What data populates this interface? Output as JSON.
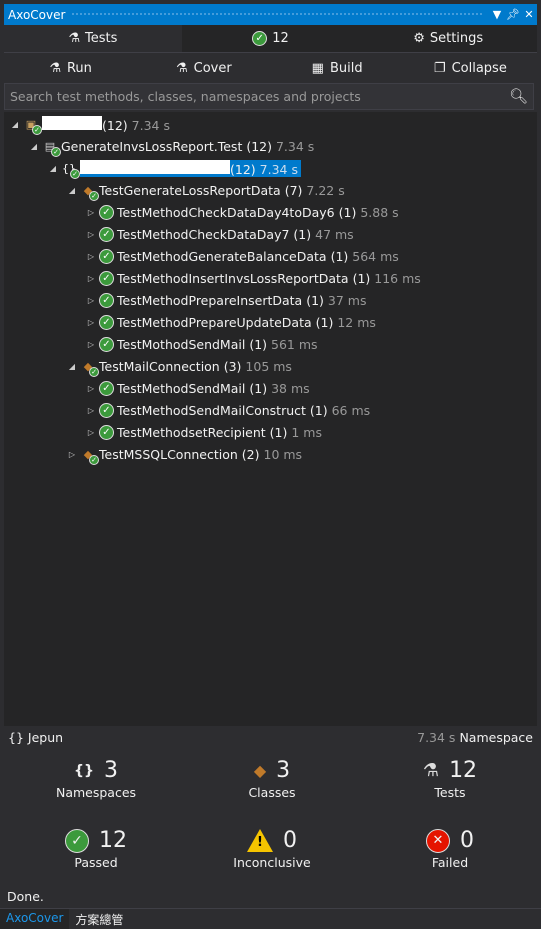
{
  "window": {
    "title": "AxoCover"
  },
  "tabs": [
    {
      "label": "Tests",
      "icon": "flask-tests-icon"
    },
    {
      "label": "12",
      "icon": "check-circle-icon"
    },
    {
      "label": "Settings",
      "icon": "gear-icon"
    }
  ],
  "toolbar": {
    "run": "Run",
    "cover": "Cover",
    "build": "Build",
    "collapse": "Collapse"
  },
  "search": {
    "placeholder": "Search test methods, classes, namespaces and projects"
  },
  "tree": [
    {
      "level": 0,
      "kind": "solution",
      "name": "",
      "redacted": true,
      "count": "(12)",
      "time": "7.34 s",
      "expanded": true
    },
    {
      "level": 1,
      "kind": "project",
      "name": "GenerateInvsLossReport.Test",
      "count": "(12)",
      "time": "7.34 s",
      "expanded": true
    },
    {
      "level": 2,
      "kind": "namespace",
      "name": "",
      "redacted": true,
      "count": "(12)",
      "time": "7.34 s",
      "expanded": true,
      "selected": true
    },
    {
      "level": 3,
      "kind": "class",
      "name": "TestGenerateLossReportData",
      "count": "(7)",
      "time": "7.22 s",
      "expanded": true
    },
    {
      "level": 4,
      "kind": "test",
      "name": "TestMethodCheckDataDay4toDay6",
      "count": "(1)",
      "time": "5.88 s"
    },
    {
      "level": 4,
      "kind": "test",
      "name": "TestMethodCheckDataDay7",
      "count": "(1)",
      "time": "47 ms"
    },
    {
      "level": 4,
      "kind": "test",
      "name": "TestMethodGenerateBalanceData",
      "count": "(1)",
      "time": "564 ms"
    },
    {
      "level": 4,
      "kind": "test",
      "name": "TestMethodInsertInvsLossReportData",
      "count": "(1)",
      "time": "116 ms"
    },
    {
      "level": 4,
      "kind": "test",
      "name": "TestMethodPrepareInsertData",
      "count": "(1)",
      "time": "37 ms"
    },
    {
      "level": 4,
      "kind": "test",
      "name": "TestMethodPrepareUpdateData",
      "count": "(1)",
      "time": "12 ms"
    },
    {
      "level": 4,
      "kind": "test",
      "name": "TestMothodSendMail",
      "count": "(1)",
      "time": "561 ms"
    },
    {
      "level": 3,
      "kind": "class",
      "name": "TestMailConnection",
      "count": "(3)",
      "time": "105 ms",
      "expanded": true
    },
    {
      "level": 4,
      "kind": "test",
      "name": "TestMethodSendMail",
      "count": "(1)",
      "time": "38 ms"
    },
    {
      "level": 4,
      "kind": "test",
      "name": "TestMethodSendMailConstruct",
      "count": "(1)",
      "time": "66 ms"
    },
    {
      "level": 4,
      "kind": "test",
      "name": "TestMethodsetRecipient",
      "count": "(1)",
      "time": "1 ms"
    },
    {
      "level": 3,
      "kind": "class",
      "name": "TestMSSQLConnection",
      "count": "(2)",
      "time": "10 ms",
      "expanded": false
    }
  ],
  "details": {
    "name": "Jepun",
    "time": "7.34 s",
    "type": "Namespace"
  },
  "stats": [
    {
      "value": "3",
      "label": "Namespaces",
      "icon": "namespace-icon"
    },
    {
      "value": "3",
      "label": "Classes",
      "icon": "class-icon"
    },
    {
      "value": "12",
      "label": "Tests",
      "icon": "flask-icon"
    },
    {
      "value": "12",
      "label": "Passed",
      "icon": "passed-icon"
    },
    {
      "value": "0",
      "label": "Inconclusive",
      "icon": "warning-icon"
    },
    {
      "value": "0",
      "label": "Failed",
      "icon": "failed-icon"
    }
  ],
  "status": "Done.",
  "bottom_tabs": [
    "AxoCover",
    "方案總管"
  ]
}
